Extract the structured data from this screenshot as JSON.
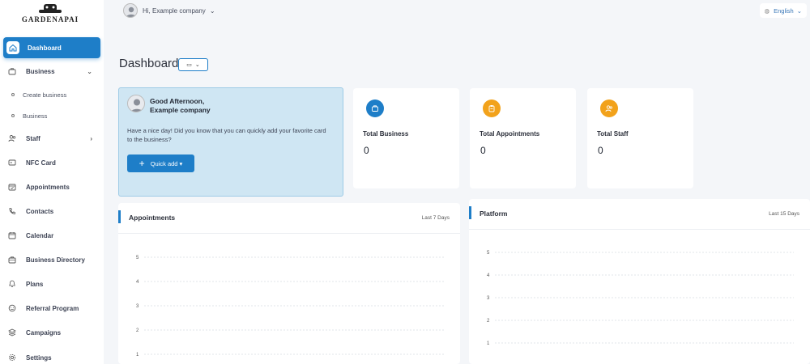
{
  "app": {
    "logo_text": "GARDENAPAI"
  },
  "topbar": {
    "user_greeting": "Hi, Example company",
    "language": "English"
  },
  "sidebar": {
    "items": [
      {
        "label": "Dashboard",
        "icon": "home-icon",
        "active": true
      },
      {
        "label": "Business",
        "icon": "briefcase-icon",
        "chevron": "⌄"
      },
      {
        "label": "Staff",
        "icon": "users-icon",
        "chevron": "›"
      },
      {
        "label": "NFC Card",
        "icon": "card-icon"
      },
      {
        "label": "Appointments",
        "icon": "calendar-check-icon"
      },
      {
        "label": "Contacts",
        "icon": "phone-icon"
      },
      {
        "label": "Calendar",
        "icon": "calendar-icon"
      },
      {
        "label": "Business Directory",
        "icon": "directory-icon"
      },
      {
        "label": "Plans",
        "icon": "plans-icon"
      },
      {
        "label": "Referral Program",
        "icon": "referral-icon"
      },
      {
        "label": "Campaigns",
        "icon": "campaign-icon"
      },
      {
        "label": "Settings",
        "icon": "gear-icon"
      }
    ],
    "business_sub": [
      "Create business",
      "Business"
    ]
  },
  "page": {
    "title": "Dashboard"
  },
  "welcome": {
    "greeting_line1": "Good Afternoon,",
    "greeting_line2": "Example company",
    "message": "Have a nice day! Did you know that you can quickly add your favorite card to the business?",
    "quick_add": "Quick add ▾"
  },
  "stats": [
    {
      "label": "Total Business",
      "value": "0",
      "color": "#1e7ec8",
      "icon": "business-icon"
    },
    {
      "label": "Total Appointments",
      "value": "0",
      "color": "#f2a21b",
      "icon": "clipboard-icon"
    },
    {
      "label": "Total Staff",
      "value": "0",
      "color": "#f2a21b",
      "icon": "staff-icon"
    }
  ],
  "chart_data": [
    {
      "type": "line",
      "title": "Appointments",
      "range_label": "Last 7 Days",
      "y_ticks": [
        "5",
        "4",
        "3",
        "2",
        "1"
      ],
      "ylim": [
        0,
        5
      ],
      "grid": true,
      "series": []
    },
    {
      "type": "line",
      "title": "Platform",
      "range_label": "Last 15 Days",
      "y_ticks": [
        "5",
        "4",
        "3",
        "2",
        "1"
      ],
      "ylim": [
        0,
        5
      ],
      "grid": true,
      "series": []
    }
  ],
  "colors": {
    "primary": "#1e7ec8",
    "warning": "#f2a21b",
    "welcome_bg": "#cfe6f3"
  }
}
